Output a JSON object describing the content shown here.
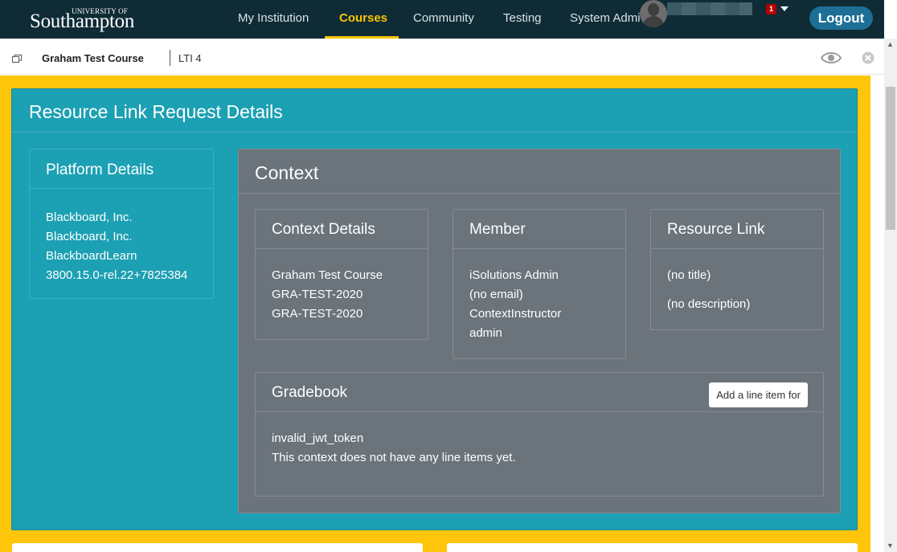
{
  "header": {
    "logo_small": "UNIVERSITY OF",
    "logo_big": "Southampton",
    "nav": [
      {
        "label": "My Institution"
      },
      {
        "label": "Courses"
      },
      {
        "label": "Community"
      },
      {
        "label": "Testing"
      },
      {
        "label": "System Admin"
      }
    ],
    "active_nav": "Courses",
    "notification_count": "1",
    "logout_label": "Logout"
  },
  "breadcrumb": {
    "course": "Graham Test Course",
    "page": "LTI 4"
  },
  "main": {
    "title": "Resource Link Request Details",
    "platform": {
      "title": "Platform Details",
      "lines": [
        "Blackboard, Inc.",
        "Blackboard, Inc.",
        "BlackboardLearn",
        "3800.15.0-rel.22+7825384"
      ]
    },
    "context": {
      "title": "Context",
      "context_details": {
        "title": "Context Details",
        "lines": [
          "Graham Test Course",
          "GRA-TEST-2020",
          "GRA-TEST-2020"
        ]
      },
      "member": {
        "title": "Member",
        "lines": [
          "iSolutions Admin",
          "(no email)",
          "ContextInstructor",
          "admin"
        ]
      },
      "resource_link": {
        "title": "Resource Link",
        "lines": [
          "(no title)",
          "(no description)"
        ]
      },
      "gradebook": {
        "title": "Gradebook",
        "button_label": "Add a line item for",
        "lines": [
          "invalid_jwt_token",
          "This context does not have any line items yet."
        ]
      }
    }
  },
  "colors": {
    "topbar": "#0e2b36",
    "accent": "#f7c500",
    "panel_teal": "#1ca0b3",
    "panel_grey": "#6b737b",
    "logout": "#1d6f96"
  }
}
